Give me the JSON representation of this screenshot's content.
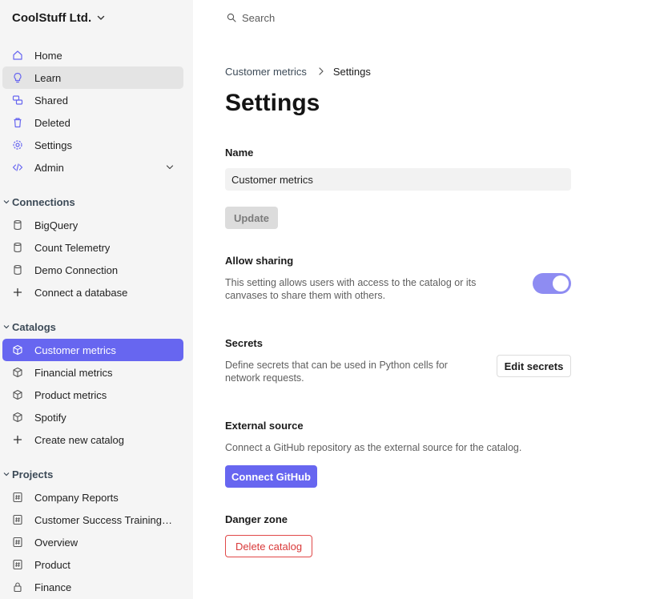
{
  "org": {
    "name": "CoolStuff Ltd."
  },
  "nav": {
    "home": "Home",
    "learn": "Learn",
    "shared": "Shared",
    "deleted": "Deleted",
    "settings": "Settings",
    "admin": "Admin"
  },
  "connections": {
    "header": "Connections",
    "items": [
      "BigQuery",
      "Count Telemetry",
      "Demo Connection"
    ],
    "add": "Connect a database"
  },
  "catalogs": {
    "header": "Catalogs",
    "items": [
      "Customer metrics",
      "Financial metrics",
      "Product metrics",
      "Spotify"
    ],
    "selected": "Customer metrics",
    "add": "Create new catalog"
  },
  "projects": {
    "header": "Projects",
    "items": [
      "Company Reports",
      "Customer Success Training ...",
      "Overview",
      "Product",
      "Finance"
    ]
  },
  "search": {
    "placeholder": "Search"
  },
  "breadcrumb": {
    "parent": "Customer metrics",
    "current": "Settings"
  },
  "page": {
    "title": "Settings"
  },
  "name_section": {
    "label": "Name",
    "value": "Customer metrics",
    "update_label": "Update"
  },
  "sharing": {
    "label": "Allow sharing",
    "description": "This setting allows users with access to the catalog or its canvases to share them with others.",
    "enabled": true
  },
  "secrets": {
    "label": "Secrets",
    "description": "Define secrets that can be used in Python cells for network requests.",
    "button": "Edit secrets"
  },
  "external": {
    "label": "External source",
    "description": "Connect a GitHub repository as the external source for the catalog.",
    "button": "Connect GitHub"
  },
  "danger": {
    "label": "Danger zone",
    "button": "Delete catalog"
  },
  "colors": {
    "accent": "#6766f0",
    "danger": "#d93939",
    "sidebar_bg": "#f5f5f5"
  }
}
